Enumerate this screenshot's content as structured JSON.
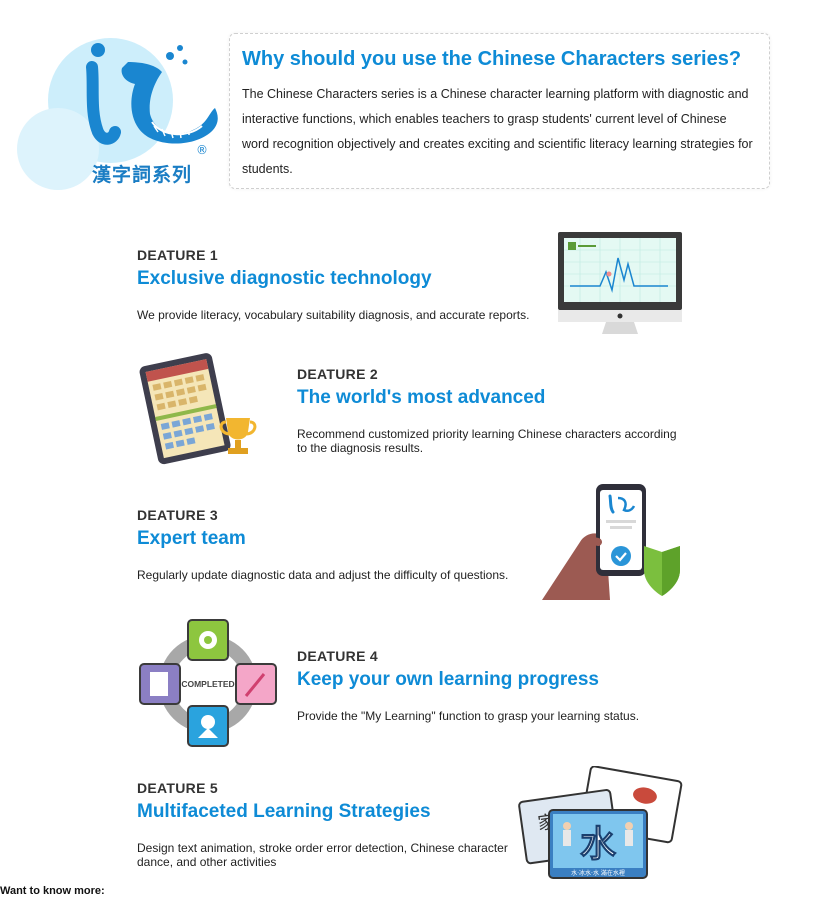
{
  "header": {
    "brand_text": "漢字詞系列",
    "title": "Why should you use the Chinese Characters series?",
    "description": "The Chinese Characters series is a Chinese character learning platform with diagnostic and interactive functions, which enables teachers to grasp students' current level of Chinese word recognition objectively and creates exciting and scientific literacy learning strategies for students."
  },
  "features": [
    {
      "tag": "DEATURE 1",
      "title": "Exclusive diagnostic technology",
      "description": "We provide literacy, vocabulary suitability diagnosis, and accurate reports."
    },
    {
      "tag": "DEATURE 2",
      "title": "The world's most advanced",
      "description": "Recommend customized priority learning Chinese characters according to the diagnosis results."
    },
    {
      "tag": "DEATURE 3",
      "title": "Expert team",
      "description": "Regularly update diagnostic data and adjust the difficulty of questions."
    },
    {
      "tag": "DEATURE 4",
      "title": "Keep your own learning progress",
      "description": "Provide the \"My Learning\" function to grasp your learning status."
    },
    {
      "tag": "DEATURE 5",
      "title": "Multifaceted Learning Strategies",
      "description": "Design text animation, stroke order error detection, Chinese character dance, and other activities"
    }
  ],
  "illustrations": {
    "cycle_label": "COMPLETED",
    "card_character": "水",
    "card_side_character": "家",
    "card_caption": "水·冰水·水 滿在水裡"
  },
  "footer": {
    "text": "Want to know more:"
  },
  "colors": {
    "accent": "#0e8bd6",
    "highlight": "#bfe6fb"
  }
}
